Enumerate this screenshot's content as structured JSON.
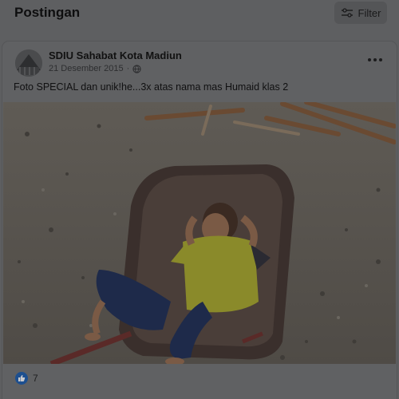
{
  "section": {
    "title": "Postingan"
  },
  "filter": {
    "label": "Filter",
    "icon": "sliders-icon"
  },
  "post": {
    "author": "SDIU Sahabat Kota Madiun",
    "date": "21 Desember 2015",
    "separator": "·",
    "privacy_icon": "globe-icon",
    "text": "Foto SPECIAL dan unik!he...3x atas nama mas Humaid klas 2",
    "photo_description": "child in wheelbarrow",
    "reaction_icon": "like-icon",
    "reaction_count": "7"
  },
  "colors": {
    "overlay_bg": "#5e5f61",
    "like_blue": "#1d4f8f"
  }
}
